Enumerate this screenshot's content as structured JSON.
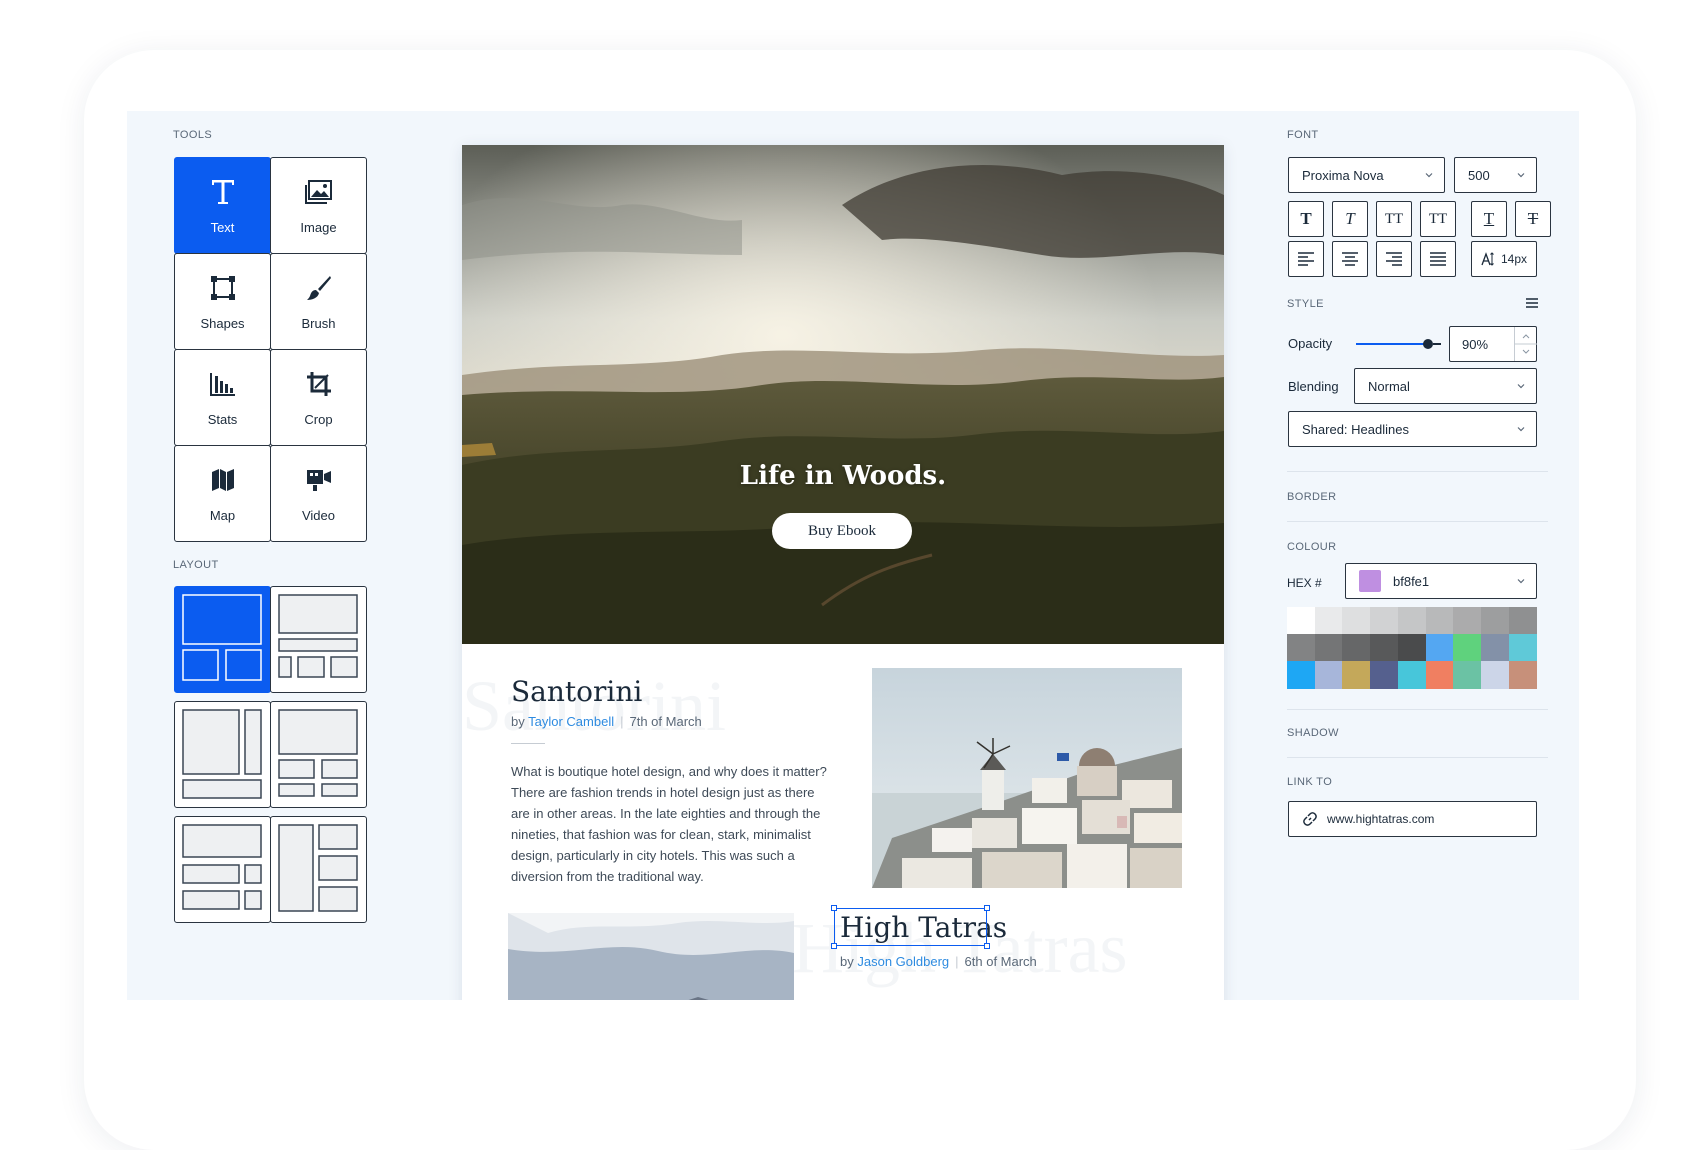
{
  "tools": {
    "heading": "TOOLS",
    "items": [
      {
        "label": "Text",
        "icon": "text-icon",
        "active": true
      },
      {
        "label": "Image",
        "icon": "image-icon"
      },
      {
        "label": "Shapes",
        "icon": "shapes-icon"
      },
      {
        "label": "Brush",
        "icon": "brush-icon"
      },
      {
        "label": "Stats",
        "icon": "stats-icon"
      },
      {
        "label": "Crop",
        "icon": "crop-icon"
      },
      {
        "label": "Map",
        "icon": "map-icon"
      },
      {
        "label": "Video",
        "icon": "video-icon"
      }
    ]
  },
  "layout": {
    "heading": "LAYOUT",
    "options": [
      "layout-1",
      "layout-2",
      "layout-3",
      "layout-4",
      "layout-5",
      "layout-6"
    ],
    "active_index": 0
  },
  "canvas": {
    "hero": {
      "title": "Life in Woods.",
      "button": "Buy Ebook"
    },
    "article1": {
      "title": "Santorini",
      "ghost": "Santorini",
      "by": "by",
      "author": "Taylor Cambell",
      "date": "7th of March",
      "body": "What is boutique hotel design, and why does it matter? There are fashion trends in hotel design just as there are in other areas. In the late eighties and through the nineties, that fashion was for clean, stark, minimalist design, particularly in city hotels. This was such a diversion from the traditional way."
    },
    "article2": {
      "title": "High Tatras",
      "ghost": "High Tatras",
      "by": "by",
      "author": "Jason Goldberg",
      "date": "6th of March"
    }
  },
  "font": {
    "heading": "FONT",
    "family": "Proxima Nova",
    "weight": "500",
    "styles": [
      "T",
      "T",
      "TT",
      "TT",
      "T",
      "T"
    ],
    "size": "14px"
  },
  "style": {
    "heading": "STYLE",
    "opacity_label": "Opacity",
    "opacity_value": "90%",
    "opacity_fraction": 0.9,
    "blending_label": "Blending",
    "blending_value": "Normal",
    "shared": "Shared: Headlines"
  },
  "border": {
    "heading": "BORDER"
  },
  "colour": {
    "heading": "COLOUR",
    "hex_label": "HEX #",
    "hex_value": "bf8fe1",
    "current": "#bf8fe1",
    "palette": [
      "#ffffff",
      "#e9eaeb",
      "#dedfe0",
      "#d1d2d3",
      "#c5c6c7",
      "#b8b9ba",
      "#ababac",
      "#9d9e9f",
      "#8f9091",
      "#828384",
      "#747576",
      "#666768",
      "#58595a",
      "#4a4b4c",
      "#54a7f2",
      "#5fd27d",
      "#8391a8",
      "#5fc9d8",
      "#1ea7f4",
      "#a7b6da",
      "#c4a85a",
      "#55608e",
      "#47c6da",
      "#f07f61",
      "#6bc2a4",
      "#ccd5e8",
      "#c7907a"
    ]
  },
  "shadow": {
    "heading": "SHADOW"
  },
  "link": {
    "heading": "LINK TO",
    "url": "www.hightatras.com"
  }
}
